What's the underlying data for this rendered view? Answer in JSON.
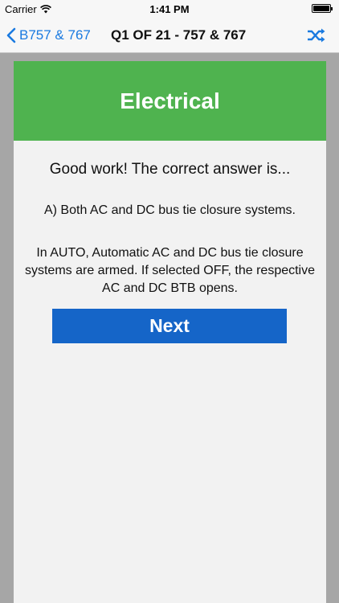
{
  "status_bar": {
    "carrier": "Carrier",
    "time": "1:41 PM"
  },
  "nav": {
    "back_label": "B757 & 767",
    "title": "Q1 OF 21 - 757 & 767",
    "accent_color": "#1a7ae0"
  },
  "card": {
    "category": "Electrical",
    "header_color": "#4fb34f",
    "result_title": "Good work! The correct answer is...",
    "answer": "A) Both AC and DC bus tie closure systems.",
    "explanation": "In AUTO, Automatic AC and DC bus tie closure systems are armed.  If selected OFF, the respective AC and DC BTB opens.",
    "next_label": "Next",
    "next_color": "#1565c8"
  },
  "icons": [
    "wifi-icon",
    "battery-icon",
    "chevron-left-icon",
    "shuffle-icon"
  ]
}
